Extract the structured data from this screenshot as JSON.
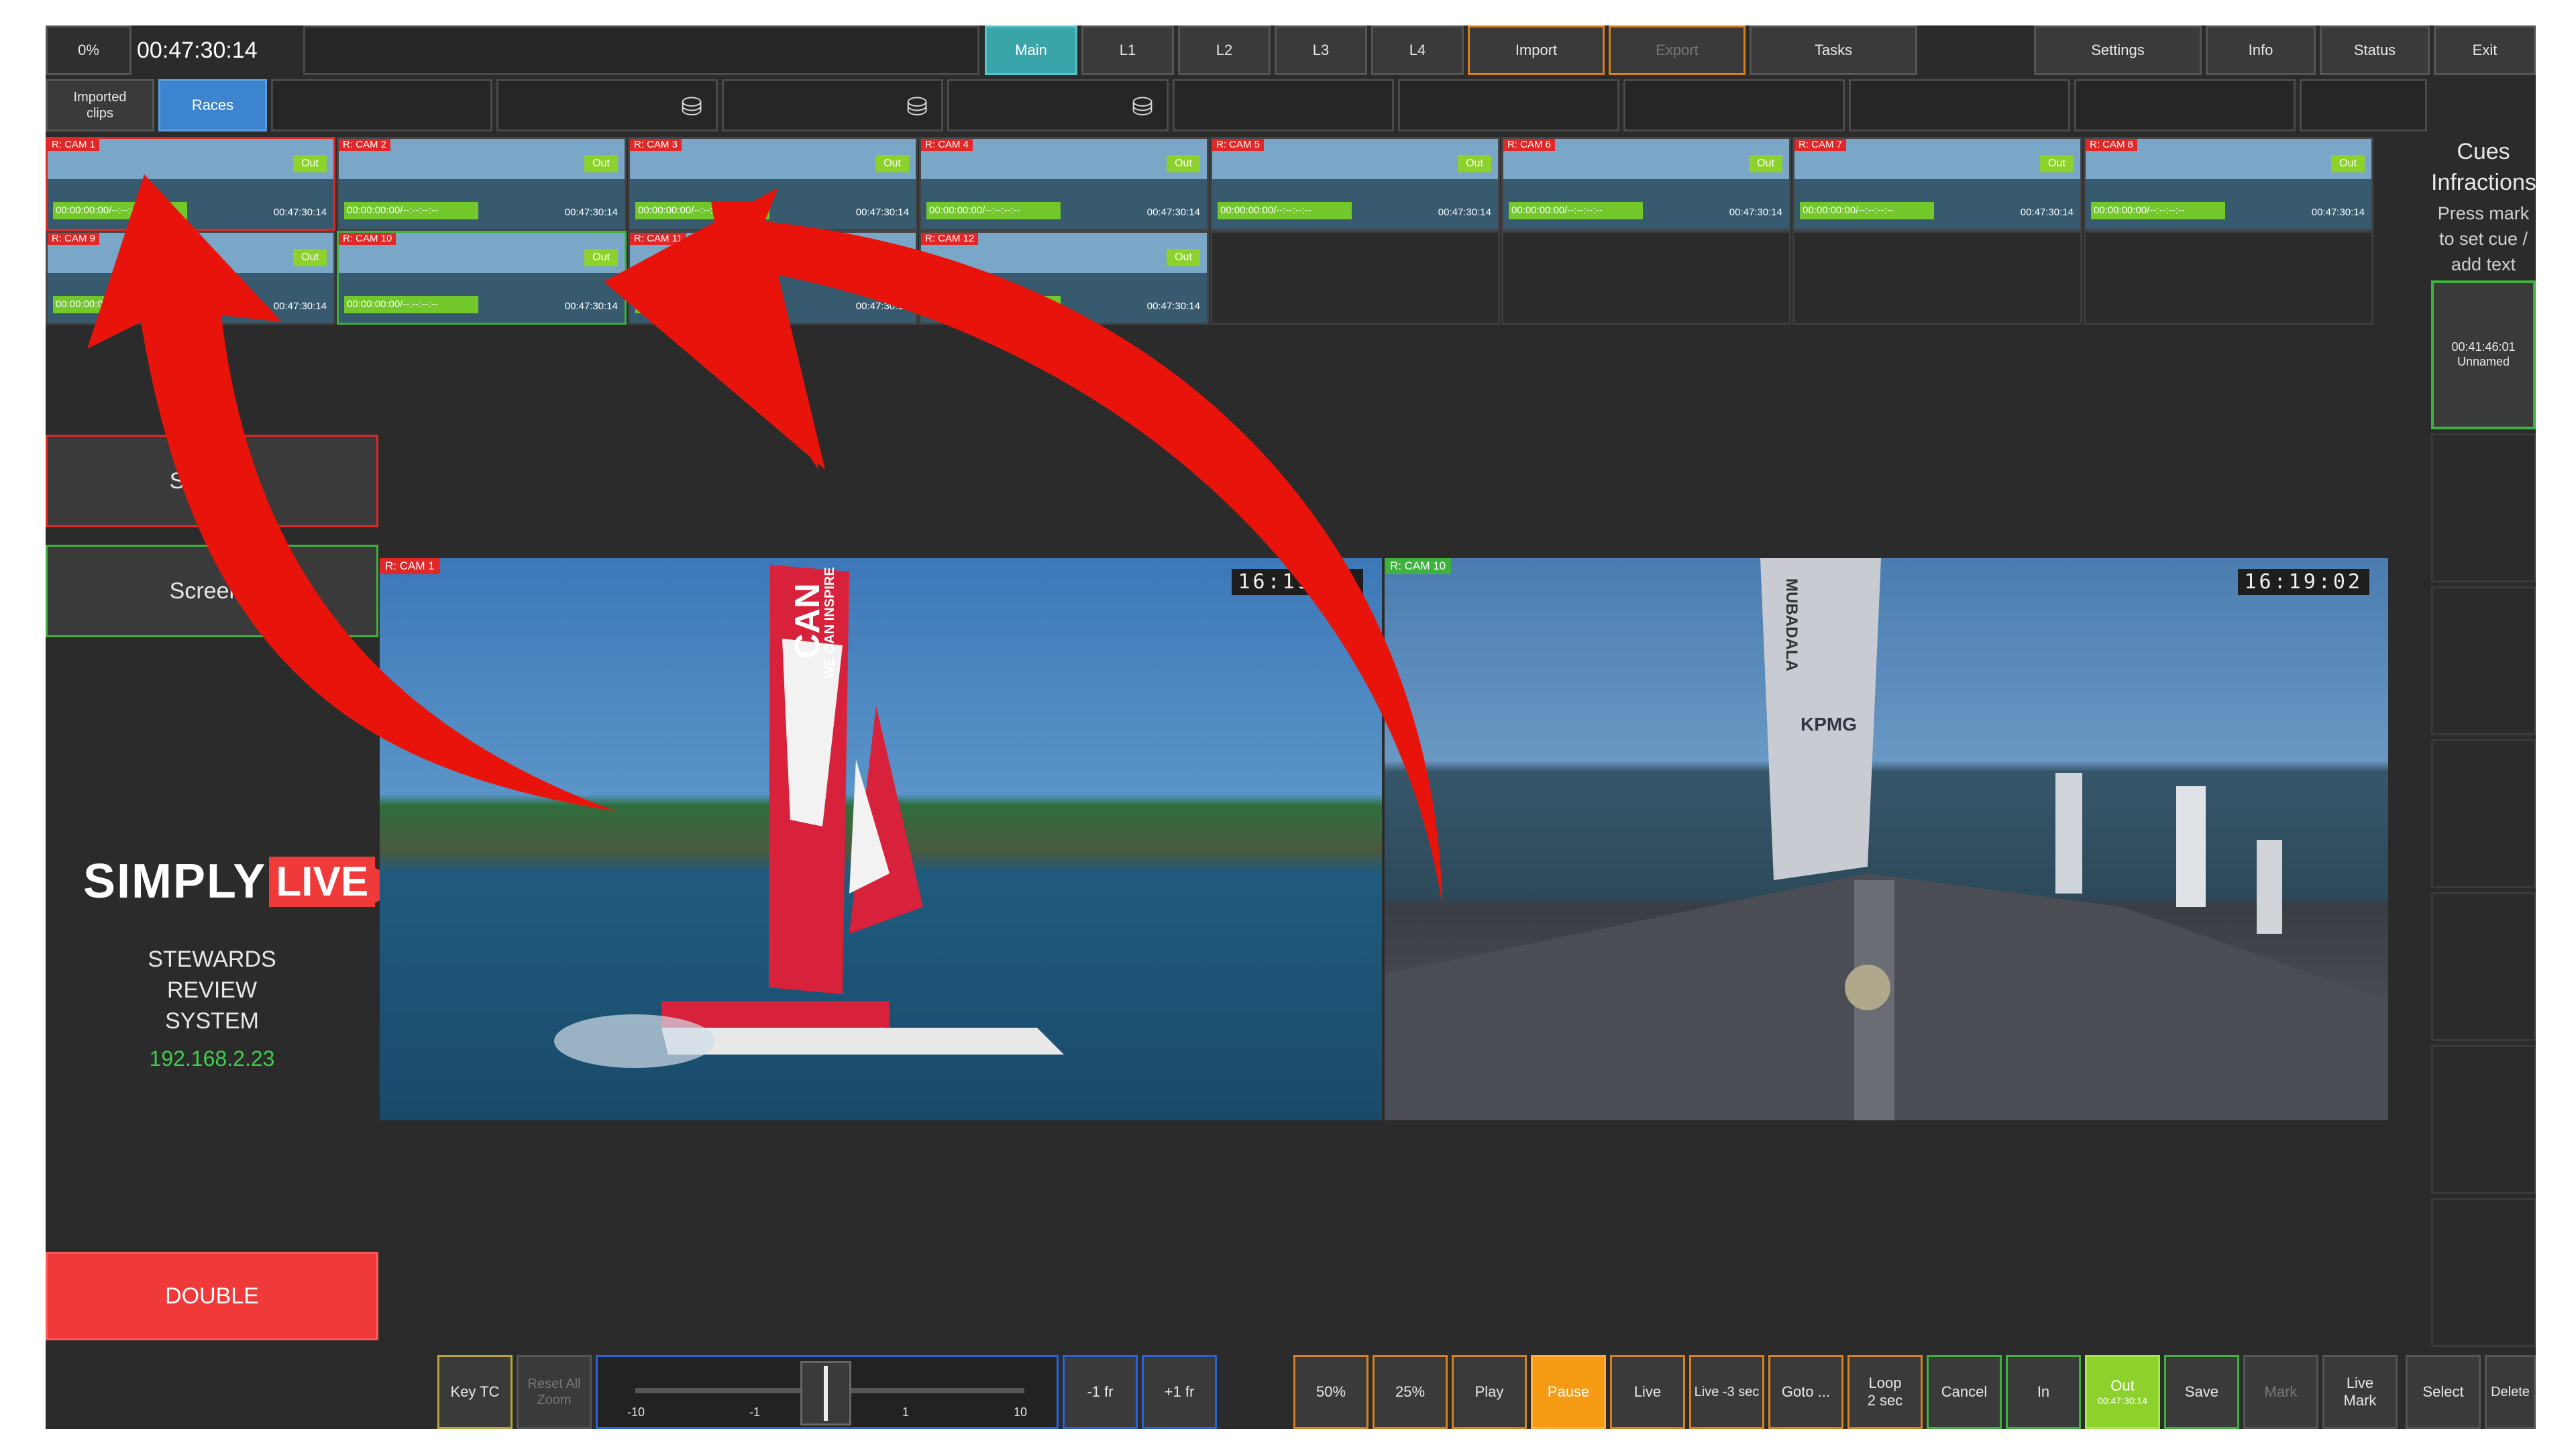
{
  "topbar": {
    "progress": "0%",
    "timecode": "00:47:30:14",
    "buttons": [
      "Main",
      "L1",
      "L2",
      "L3",
      "L4",
      "Import",
      "Export",
      "Tasks"
    ],
    "right_buttons": [
      "Settings",
      "Info",
      "Status",
      "Exit"
    ]
  },
  "secondbar": {
    "imported_clips": "Imported\nclips",
    "races": "Races"
  },
  "clips": [
    {
      "label": "R: CAM 1",
      "out": "Out",
      "tc_in": "00:00:00:00/--:--:--:--",
      "tc_out": "00:47:30:14"
    },
    {
      "label": "R: CAM 2",
      "out": "Out",
      "tc_in": "00:00:00:00/--:--:--:--",
      "tc_out": "00:47:30:14"
    },
    {
      "label": "R: CAM 3",
      "out": "Out",
      "tc_in": "00:00:00:00/--:--:--:--",
      "tc_out": "00:47:30:14"
    },
    {
      "label": "R: CAM 4",
      "out": "Out",
      "tc_in": "00:00:00:00/--:--:--:--",
      "tc_out": "00:47:30:14"
    },
    {
      "label": "R: CAM 5",
      "out": "Out",
      "tc_in": "00:00:00:00/--:--:--:--",
      "tc_out": "00:47:30:14"
    },
    {
      "label": "R: CAM 6",
      "out": "Out",
      "tc_in": "00:00:00:00/--:--:--:--",
      "tc_out": "00:47:30:14"
    },
    {
      "label": "R: CAM 7",
      "out": "Out",
      "tc_in": "00:00:00:00/--:--:--:--",
      "tc_out": "00:47:30:14"
    },
    {
      "label": "R: CAM 8",
      "out": "Out",
      "tc_in": "00:00:00:00/--:--:--:--",
      "tc_out": "00:47:30:14"
    },
    {
      "label": "R: CAM 9",
      "out": "Out",
      "tc_in": "00:00:00:00/--:--:--:--",
      "tc_out": "00:47:30:14"
    },
    {
      "label": "R: CAM 10",
      "out": "Out",
      "tc_in": "00:00:00:00/--:--:--:--",
      "tc_out": "00:47:30:14"
    },
    {
      "label": "R: CAM 11",
      "out": "Out",
      "tc_in": "00:00:00:00/--:--:--:--",
      "tc_out": "00:47:30:14"
    },
    {
      "label": "R: CAM 12",
      "out": "Out",
      "tc_in": "00:00:00:00/--:--:--:--",
      "tc_out": "00:47:30:14"
    }
  ],
  "cues": {
    "title": "Cues\nInfractions",
    "hint": "Press mark\nto set cue /\nadd text",
    "cue1": "00:41:46:01\nUnnamed"
  },
  "screens": {
    "screen1": "Screen1",
    "screen2": "Screen2"
  },
  "brand": {
    "simply": "SIMPLY",
    "live": "LIVE",
    "system": "STEWARDS\nREVIEW\nSYSTEM",
    "ip": "192.168.2.23"
  },
  "double": "DOUBLE",
  "videos": {
    "left_label": "R: CAM 1",
    "left_tc": "16:19:02",
    "right_label": "R: CAM 10",
    "right_tc": "16:19:02",
    "sail_text_1": "CAN",
    "sail_text_2": "WE CAN INSPIRE",
    "mast_text": "MUBADALA",
    "kpmg": "KPMG"
  },
  "bottombar": {
    "key_tc": "Key TC",
    "reset_zoom": "Reset All\nZoom",
    "slider_ticks": [
      "-10",
      "-1",
      "1",
      "10"
    ],
    "minus_fr": "-1 fr",
    "plus_fr": "+1 fr",
    "buttons": [
      "50%",
      "25%",
      "Play",
      "Pause",
      "Live",
      "Live -3 sec",
      "Goto ...",
      "Loop\n2 sec",
      "Cancel",
      "In"
    ],
    "out": "Out",
    "out_tc": "00:47:30:14",
    "save": "Save",
    "mark": "Mark",
    "live_mark": "Live\nMark",
    "select": "Select",
    "delete": "Delete"
  },
  "colors": {
    "accent_teal": "#3aa4ab",
    "accent_orange": "#f59a12",
    "accent_green": "#8dd22c",
    "accent_red": "#f03a3a",
    "accent_blue": "#3c84d0",
    "ip_green": "#3fd04a"
  }
}
